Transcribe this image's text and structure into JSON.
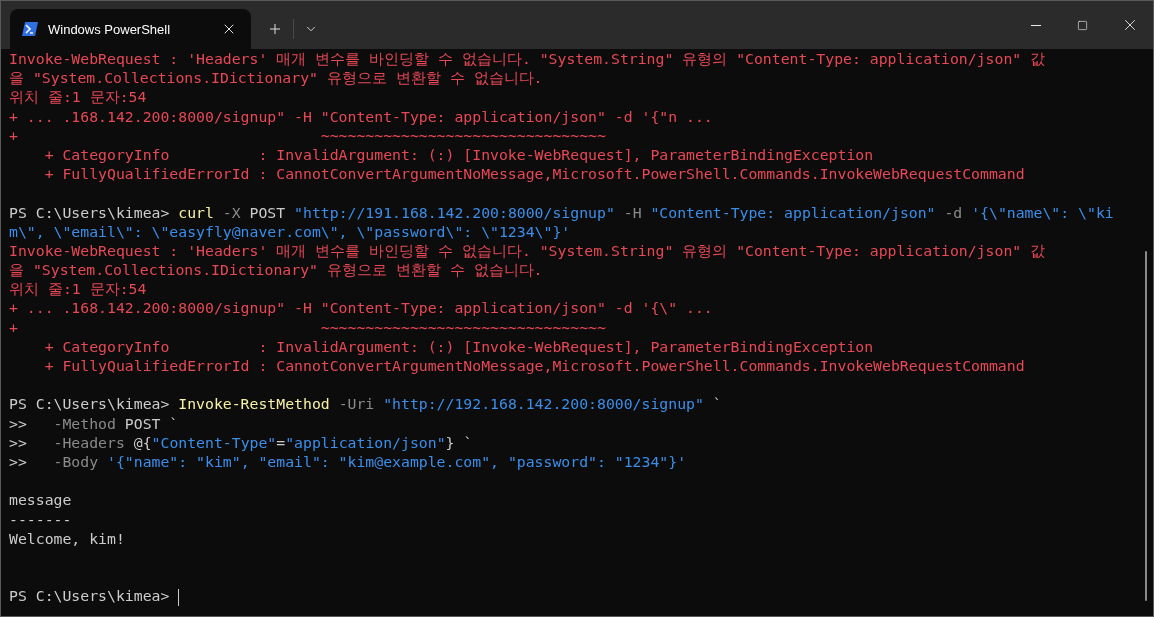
{
  "tab": {
    "title": "Windows PowerShell"
  },
  "lines": [
    {
      "kind": "text",
      "segments": [
        {
          "kind": "err",
          "text": "Invoke-WebRequest : 'Headers' 매개 변수를 바인딩할 수 없습니다. \"System.String\" 유형의 \"Content-Type: application/json\" 값"
        }
      ]
    },
    {
      "kind": "text",
      "segments": [
        {
          "kind": "err",
          "text": "을 \"System.Collections.IDictionary\" 유형으로 변환할 수 없습니다."
        }
      ]
    },
    {
      "kind": "text",
      "segments": [
        {
          "kind": "err",
          "text": "위치 줄:1 문자:54"
        }
      ]
    },
    {
      "kind": "text",
      "segments": [
        {
          "kind": "err",
          "text": "+ ... .168.142.200:8000/signup\" -H \"Content-Type: application/json\" -d '{\"n ..."
        }
      ]
    },
    {
      "kind": "text",
      "segments": [
        {
          "kind": "err",
          "text": "+                                  ~~~~~~~~~~~~~~~~~~~~~~~~~~~~~~~~"
        }
      ]
    },
    {
      "kind": "text",
      "segments": [
        {
          "kind": "err",
          "text": "    + CategoryInfo          : InvalidArgument: (:) [Invoke-WebRequest], ParameterBindingException"
        }
      ]
    },
    {
      "kind": "text",
      "segments": [
        {
          "kind": "err",
          "text": "    + FullyQualifiedErrorId : CannotConvertArgumentNoMessage,Microsoft.PowerShell.Commands.InvokeWebRequestCommand"
        }
      ]
    },
    {
      "kind": "blank"
    },
    {
      "kind": "text",
      "segments": [
        {
          "kind": "plain",
          "text": "PS C:\\Users\\kimea> "
        },
        {
          "kind": "cmd",
          "text": "curl"
        },
        {
          "kind": "param",
          "text": " -X"
        },
        {
          "kind": "plain",
          "text": " POST "
        },
        {
          "kind": "str",
          "text": "\"http://191.168.142.200:8000/signup\""
        },
        {
          "kind": "param",
          "text": " -H "
        },
        {
          "kind": "str",
          "text": "\"Content-Type: application/json\""
        },
        {
          "kind": "param",
          "text": " -d "
        },
        {
          "kind": "str",
          "text": "'{\\\"name\\\": \\\"ki"
        }
      ]
    },
    {
      "kind": "text",
      "segments": [
        {
          "kind": "str",
          "text": "m\\\", \\\"email\\\": \\\"easyfly@naver.com\\\", \\\"password\\\": \\\"1234\\\"}'"
        }
      ]
    },
    {
      "kind": "text",
      "segments": [
        {
          "kind": "err",
          "text": "Invoke-WebRequest : 'Headers' 매개 변수를 바인딩할 수 없습니다. \"System.String\" 유형의 \"Content-Type: application/json\" 값"
        }
      ]
    },
    {
      "kind": "text",
      "segments": [
        {
          "kind": "err",
          "text": "을 \"System.Collections.IDictionary\" 유형으로 변환할 수 없습니다."
        }
      ]
    },
    {
      "kind": "text",
      "segments": [
        {
          "kind": "err",
          "text": "위치 줄:1 문자:54"
        }
      ]
    },
    {
      "kind": "text",
      "segments": [
        {
          "kind": "err",
          "text": "+ ... .168.142.200:8000/signup\" -H \"Content-Type: application/json\" -d '{\\\" ..."
        }
      ]
    },
    {
      "kind": "text",
      "segments": [
        {
          "kind": "err",
          "text": "+                                  ~~~~~~~~~~~~~~~~~~~~~~~~~~~~~~~~"
        }
      ]
    },
    {
      "kind": "text",
      "segments": [
        {
          "kind": "err",
          "text": "    + CategoryInfo          : InvalidArgument: (:) [Invoke-WebRequest], ParameterBindingException"
        }
      ]
    },
    {
      "kind": "text",
      "segments": [
        {
          "kind": "err",
          "text": "    + FullyQualifiedErrorId : CannotConvertArgumentNoMessage,Microsoft.PowerShell.Commands.InvokeWebRequestCommand"
        }
      ]
    },
    {
      "kind": "blank"
    },
    {
      "kind": "text",
      "segments": [
        {
          "kind": "plain",
          "text": "PS C:\\Users\\kimea> "
        },
        {
          "kind": "cmd",
          "text": "Invoke-RestMethod"
        },
        {
          "kind": "param",
          "text": " -Uri "
        },
        {
          "kind": "str",
          "text": "\"http://192.168.142.200:8000/signup\""
        },
        {
          "kind": "plain",
          "text": " `"
        }
      ]
    },
    {
      "kind": "text",
      "segments": [
        {
          "kind": "plain",
          "text": ">>   "
        },
        {
          "kind": "param",
          "text": "-Method"
        },
        {
          "kind": "plain",
          "text": " POST `"
        }
      ]
    },
    {
      "kind": "text",
      "segments": [
        {
          "kind": "plain",
          "text": ">>   "
        },
        {
          "kind": "param",
          "text": "-Headers"
        },
        {
          "kind": "plain",
          "text": " @{"
        },
        {
          "kind": "str",
          "text": "\"Content-Type\""
        },
        {
          "kind": "plain",
          "text": "="
        },
        {
          "kind": "str",
          "text": "\"application/json\""
        },
        {
          "kind": "plain",
          "text": "} `"
        }
      ]
    },
    {
      "kind": "text",
      "segments": [
        {
          "kind": "plain",
          "text": ">>   "
        },
        {
          "kind": "param",
          "text": "-Body"
        },
        {
          "kind": "str",
          "text": " '{\"name\": \"kim\", \"email\": \"kim@example.com\", \"password\": \"1234\"}'"
        }
      ]
    },
    {
      "kind": "blank"
    },
    {
      "kind": "text",
      "segments": [
        {
          "kind": "plain",
          "text": "message"
        }
      ]
    },
    {
      "kind": "text",
      "segments": [
        {
          "kind": "plain",
          "text": "-------"
        }
      ]
    },
    {
      "kind": "text",
      "segments": [
        {
          "kind": "plain",
          "text": "Welcome, kim!"
        }
      ]
    },
    {
      "kind": "blank"
    },
    {
      "kind": "blank"
    }
  ],
  "input_line": {
    "prompt": "PS C:\\Users\\kimea> ",
    "cursor": true
  }
}
